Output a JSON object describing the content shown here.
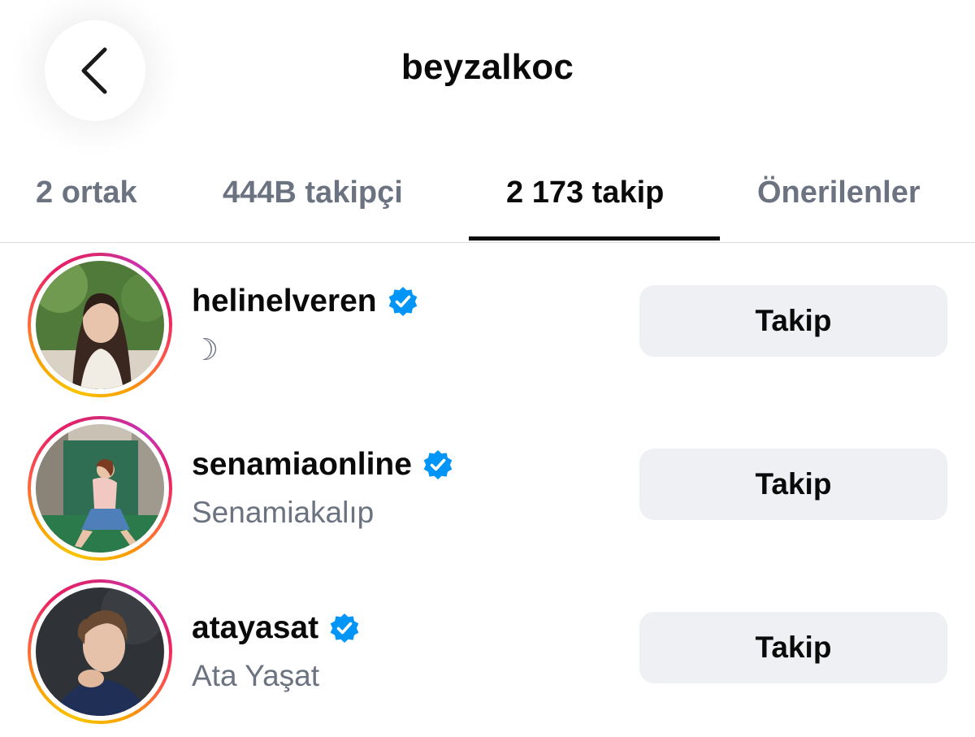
{
  "header": {
    "title": "beyzalkoc",
    "back_icon": "chevron-left-icon"
  },
  "tabs": [
    {
      "label": "2 ortak",
      "active": false
    },
    {
      "label": "444B takipçi",
      "active": false
    },
    {
      "label": "2 173 takip",
      "active": true
    },
    {
      "label": "Önerilenler",
      "active": false
    }
  ],
  "list": [
    {
      "username": "helinelveren",
      "verified": true,
      "subtitle": "☽",
      "button_label": "Takip"
    },
    {
      "username": "senamiaonline",
      "verified": true,
      "subtitle": "Senamiakalıp",
      "button_label": "Takip"
    },
    {
      "username": "atayasat",
      "verified": true,
      "subtitle": "Ata Yaşat",
      "button_label": "Takip"
    }
  ],
  "colors": {
    "text_primary": "#0a0a0a",
    "text_secondary": "#6b7280",
    "verified_blue": "#0095f6",
    "button_bg": "#eef0f3",
    "divider": "#dbdbdb"
  }
}
